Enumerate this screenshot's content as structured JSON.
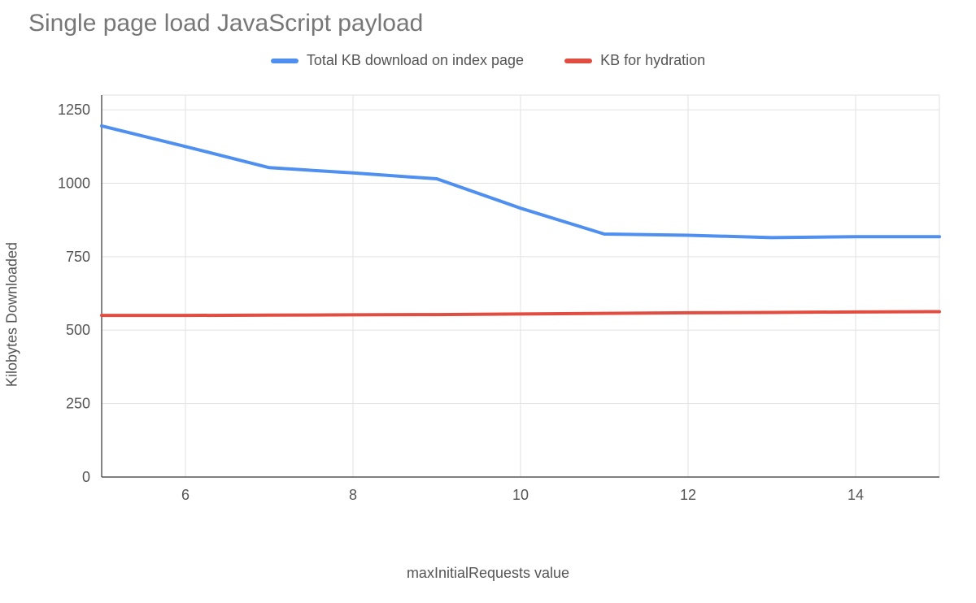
{
  "chart_data": {
    "type": "line",
    "title": "Single page load JavaScript payload",
    "xlabel": "maxInitialRequests value",
    "ylabel": "Kilobytes Downloaded",
    "xlim": [
      5,
      15
    ],
    "ylim": [
      0,
      1300
    ],
    "x_ticks": [
      6,
      8,
      10,
      12,
      14
    ],
    "y_ticks": [
      0,
      250,
      500,
      750,
      1000,
      1250
    ],
    "x": [
      5,
      6,
      7,
      8,
      9,
      10,
      11,
      12,
      13,
      14,
      15
    ],
    "series": [
      {
        "name": "Total KB download on index page",
        "color": "#4f8ff0",
        "values": [
          1195,
          1125,
          1053,
          1035,
          1015,
          915,
          827,
          823,
          815,
          818,
          818
        ]
      },
      {
        "name": "KB for hydration",
        "color": "#e24d42",
        "values": [
          550,
          550,
          551,
          552,
          553,
          555,
          557,
          559,
          560,
          562,
          563
        ]
      }
    ]
  }
}
